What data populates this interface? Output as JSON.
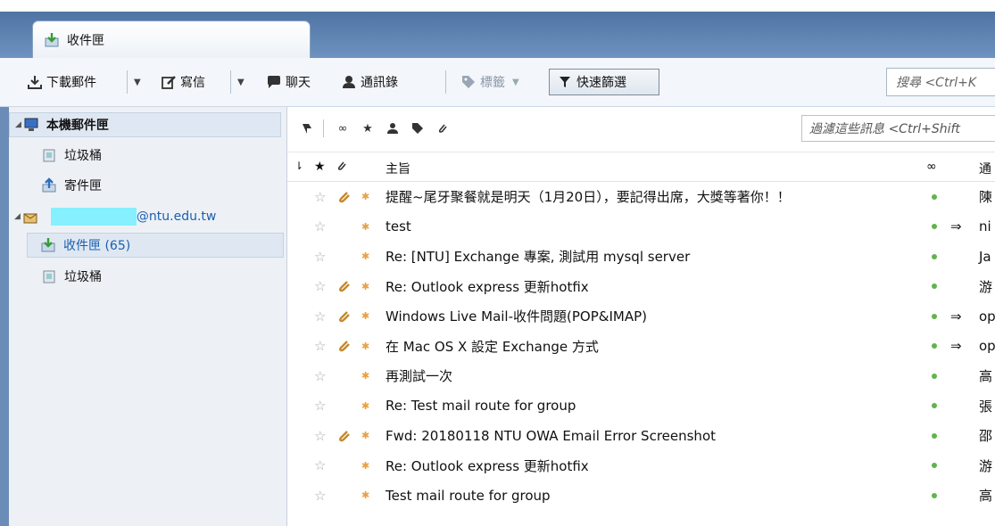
{
  "tab": {
    "label": "收件匣"
  },
  "toolbar": {
    "download_label": "下載郵件",
    "write_label": "寫信",
    "chat_label": "聊天",
    "addressbook_label": "通訊錄",
    "tag_label": "標籤",
    "quickfilter_label": "快速篩選",
    "search_placeholder": "搜尋 <Ctrl+K"
  },
  "sidebar": {
    "local_folders": "本機郵件匣",
    "local_trash": "垃圾桶",
    "local_sent": "寄件匣",
    "account_email": "@ntu.edu.tw",
    "inbox_label": "收件匣 (65)",
    "account_trash": "垃圾桶"
  },
  "filterbar": {
    "placeholder": "過濾這些訊息 <Ctrl+Shift"
  },
  "columns": {
    "subject": "主旨",
    "sender": "通"
  },
  "messages": [
    {
      "subject": "提醒~尾牙聚餐就是明天（1月20日），要記得出席，大獎等著你！！",
      "sender": "陳",
      "attach": true,
      "fwd": false
    },
    {
      "subject": "test",
      "sender": "ni",
      "attach": false,
      "fwd": true
    },
    {
      "subject": "Re: [NTU] Exchange 專案, 測試用 mysql server",
      "sender": "Ja",
      "attach": false,
      "fwd": false
    },
    {
      "subject": "Re: Outlook express 更新hotfix",
      "sender": "游",
      "attach": true,
      "fwd": false
    },
    {
      "subject": "Windows Live Mail-收件問題(POP&IMAP)",
      "sender": "op",
      "attach": true,
      "fwd": true
    },
    {
      "subject": "在 Mac OS X 設定 Exchange 方式",
      "sender": "op",
      "attach": true,
      "fwd": true
    },
    {
      "subject": "再測試一次",
      "sender": "高",
      "attach": false,
      "fwd": false
    },
    {
      "subject": "Re: Test mail route for group",
      "sender": "張",
      "attach": false,
      "fwd": false
    },
    {
      "subject": "Fwd: 20180118 NTU OWA Email Error Screenshot",
      "sender": "邵",
      "attach": true,
      "fwd": false
    },
    {
      "subject": "Re: Outlook express 更新hotfix",
      "sender": "游",
      "attach": false,
      "fwd": false
    },
    {
      "subject": "Test mail route for group",
      "sender": "高",
      "attach": false,
      "fwd": false
    }
  ]
}
